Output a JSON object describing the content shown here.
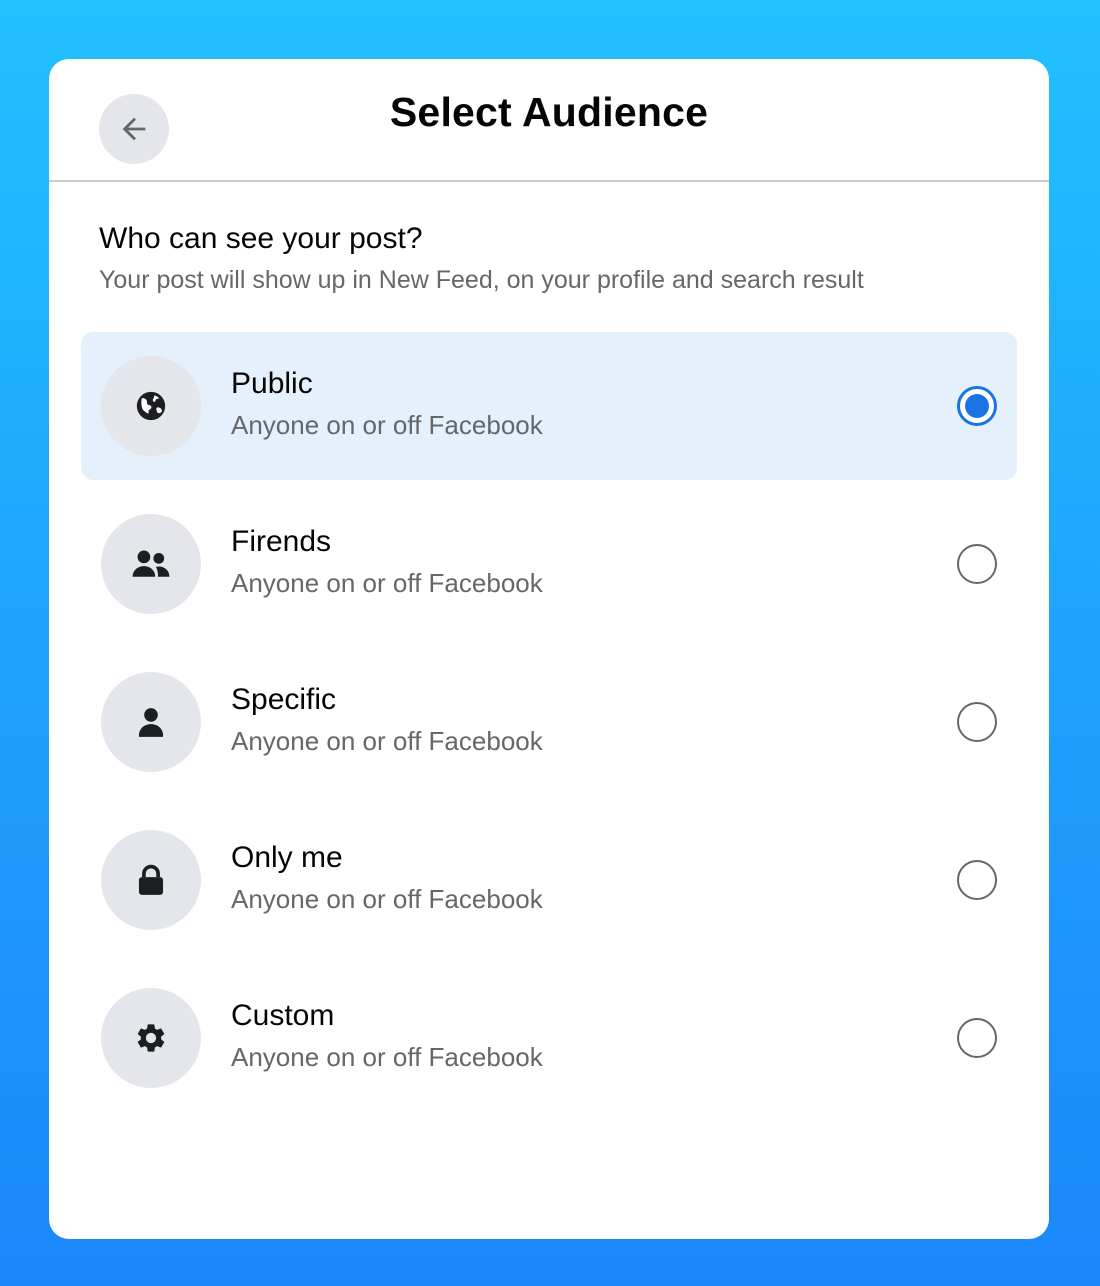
{
  "header": {
    "title": "Select Audience",
    "back_icon": "arrow-left-icon"
  },
  "intro": {
    "heading": "Who can see your post?",
    "subtext": "Your post will show up in New Feed, on your profile and search result"
  },
  "options": [
    {
      "label": "Public",
      "description": "Anyone on or off Facebook",
      "icon": "globe-icon",
      "selected": true
    },
    {
      "label": "Firends",
      "description": "Anyone on or off Facebook",
      "icon": "friends-icon",
      "selected": false
    },
    {
      "label": "Specific",
      "description": "Anyone on or off Facebook",
      "icon": "person-icon",
      "selected": false
    },
    {
      "label": "Only me",
      "description": "Anyone on or off Facebook",
      "icon": "lock-icon",
      "selected": false
    },
    {
      "label": "Custom",
      "description": "Anyone on or off Facebook",
      "icon": "gear-icon",
      "selected": false
    }
  ],
  "colors": {
    "accent": "#1b74e4",
    "selected_row": "#e5f0fd",
    "icon_circle": "#e4e6eb",
    "secondary_text": "#65676b",
    "background_top": "#22c0fe",
    "background_bottom": "#1b86fb"
  }
}
